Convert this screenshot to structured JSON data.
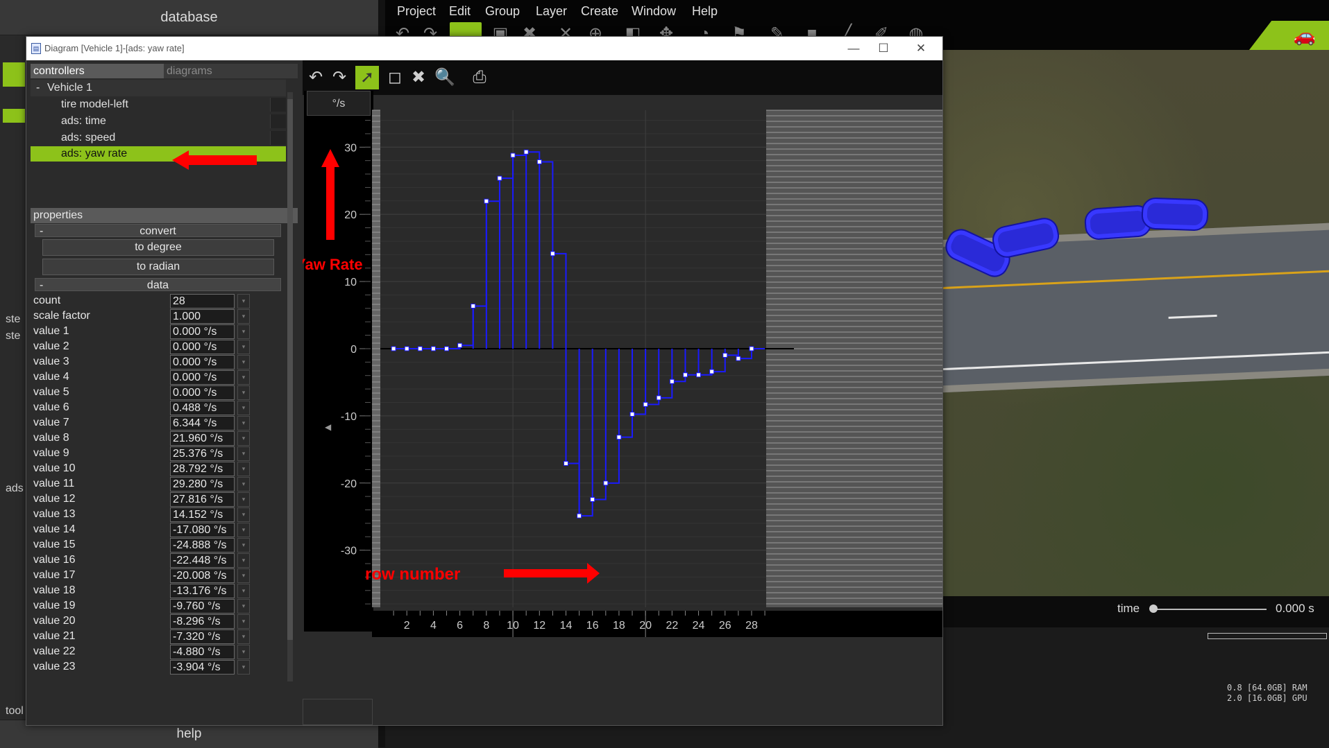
{
  "database": {
    "title": "database",
    "help": "help"
  },
  "menubar": {
    "items": [
      "Project",
      "Edit",
      "Group",
      "Layer",
      "Create",
      "Window",
      "Help"
    ]
  },
  "window": {
    "title": "Diagram [Vehicle 1]-[ads: yaw rate]",
    "minimize": "—",
    "maximize": "☐",
    "close": "✕"
  },
  "left_pane": {
    "tabs": {
      "controllers": "controllers",
      "diagrams": "diagrams"
    },
    "tree": {
      "root_toggle": "-",
      "root": "Vehicle 1",
      "items": [
        "tire model-left",
        "ads: time",
        "ads: speed",
        "ads: yaw rate"
      ],
      "selected_index": 3
    },
    "properties": {
      "header": "properties",
      "convert": {
        "toggle": "-",
        "title": "convert",
        "to_degree": "to degree",
        "to_radian": "to radian"
      },
      "data": {
        "toggle": "-",
        "title": "data"
      },
      "rows": [
        {
          "label": "count",
          "value": "28"
        },
        {
          "label": "scale factor",
          "value": "1.000"
        },
        {
          "label": "value 1",
          "value": "0.000 °/s"
        },
        {
          "label": "value 2",
          "value": "0.000 °/s"
        },
        {
          "label": "value 3",
          "value": "0.000 °/s"
        },
        {
          "label": "value 4",
          "value": "0.000 °/s"
        },
        {
          "label": "value 5",
          "value": "0.000 °/s"
        },
        {
          "label": "value 6",
          "value": "0.488 °/s"
        },
        {
          "label": "value 7",
          "value": "6.344 °/s"
        },
        {
          "label": "value 8",
          "value": "21.960 °/s"
        },
        {
          "label": "value 9",
          "value": "25.376 °/s"
        },
        {
          "label": "value 10",
          "value": "28.792 °/s"
        },
        {
          "label": "value 11",
          "value": "29.280 °/s"
        },
        {
          "label": "value 12",
          "value": "27.816 °/s"
        },
        {
          "label": "value 13",
          "value": "14.152 °/s"
        },
        {
          "label": "value 14",
          "value": "-17.080 °/s"
        },
        {
          "label": "value 15",
          "value": "-24.888 °/s"
        },
        {
          "label": "value 16",
          "value": "-22.448 °/s"
        },
        {
          "label": "value 17",
          "value": "-20.008 °/s"
        },
        {
          "label": "value 18",
          "value": "-13.176 °/s"
        },
        {
          "label": "value 19",
          "value": "-9.760 °/s"
        },
        {
          "label": "value 20",
          "value": "-8.296 °/s"
        },
        {
          "label": "value 21",
          "value": "-7.320 °/s"
        },
        {
          "label": "value 22",
          "value": "-4.880 °/s"
        },
        {
          "label": "value 23",
          "value": "-3.904 °/s"
        }
      ]
    }
  },
  "diagram": {
    "unit": "°/s",
    "annotation_y": "Yaw Rate",
    "annotation_x": "row number",
    "annotation_color": "#ff0000",
    "line_color": "#1a1aff",
    "y_ticks": [
      30,
      20,
      10,
      0,
      -10,
      -20,
      -30
    ],
    "x_ticks": [
      2,
      4,
      6,
      8,
      10,
      12,
      14,
      16,
      18,
      20,
      22,
      24,
      26,
      28
    ],
    "ylim": [
      -38.5,
      35.5
    ],
    "xlim": [
      0,
      29.1
    ]
  },
  "chart_data": {
    "type": "line",
    "x": [
      1,
      2,
      3,
      4,
      5,
      6,
      7,
      8,
      9,
      10,
      11,
      12,
      13,
      14,
      15,
      16,
      17,
      18,
      19,
      20,
      21,
      22,
      23,
      24,
      25,
      26,
      27,
      28
    ],
    "series": [
      {
        "values": [
          0,
          0,
          0,
          0,
          0,
          0.488,
          6.344,
          21.96,
          25.376,
          28.792,
          29.28,
          27.816,
          14.152,
          -17.08,
          -24.888,
          -22.448,
          -20.008,
          -13.176,
          -9.76,
          -8.296,
          -7.32,
          -4.88,
          -3.904,
          -3.904,
          -3.416,
          -0.976,
          -1.464,
          0
        ]
      }
    ],
    "ylabel": "°/s",
    "grid": true
  },
  "scene": {
    "time_label": "time",
    "time_value": "0.000 s",
    "stats": "0.8 [64.0GB] RAM\n2.0 [16.0GB] GPU"
  },
  "colors": {
    "accent": "#8dc21a",
    "window_bg": "#2b2b2b"
  }
}
